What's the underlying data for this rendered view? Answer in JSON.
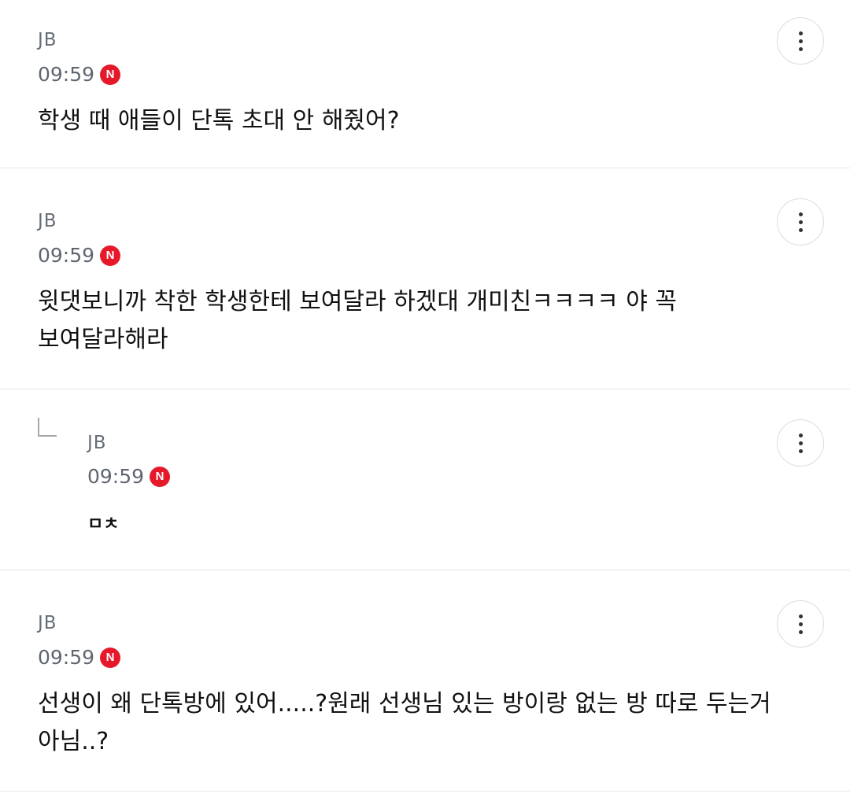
{
  "comments": [
    {
      "author": "JB",
      "time": "09:59",
      "new_badge": "N",
      "text_lines": [
        "학생 때 애들이 단톡 초대 안 해줬어?"
      ],
      "more_icon": "more-vertical-icon"
    },
    {
      "author": "JB",
      "time": "09:59",
      "new_badge": "N",
      "text_lines": [
        "윗댓보니까 착한 학생한테 보여달라 하겠대 개미친ㅋㅋㅋㅋ 야 꼭",
        "보여달라해라"
      ],
      "more_icon": "more-vertical-icon"
    },
    {
      "author": "JB",
      "time": "09:59",
      "new_badge": "N",
      "is_reply": true,
      "reply_icon": "reply-arrow-icon",
      "text_lines": [
        "ㅁㅊ"
      ],
      "more_icon": "more-vertical-icon"
    },
    {
      "author": "JB",
      "time": "09:59",
      "new_badge": "N",
      "text_lines": [
        "선생이 왜 단톡방에 있어.....?원래 선생님 있는 방이랑 없는 방 따로 두는거",
        "아님..?"
      ],
      "more_icon": "more-vertical-icon"
    }
  ],
  "colors": {
    "badge": "#e6192b",
    "meta_text": "#5f6670",
    "divider": "#e6e6e6"
  }
}
